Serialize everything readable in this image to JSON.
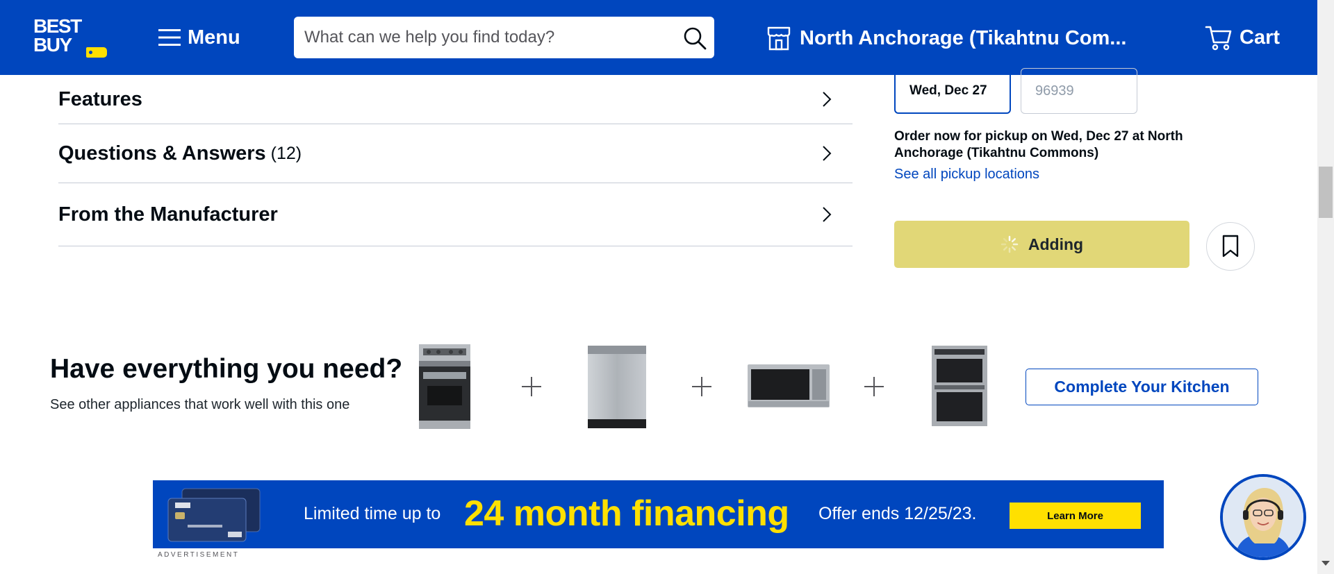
{
  "header": {
    "logo_text": "BEST BUY",
    "menu_label": "Menu",
    "search_placeholder": "What can we help you find today?",
    "store_label": "North Anchorage (Tikahtnu Com...",
    "cart_label": "Cart",
    "brand_color": "#0046be",
    "accent_color": "#ffe000"
  },
  "accordion": [
    {
      "title": "Features",
      "count": ""
    },
    {
      "title": "Questions & Answers",
      "count": "(12)"
    },
    {
      "title": "From the Manufacturer",
      "count": ""
    }
  ],
  "fulfillment": {
    "selected_date": "Wed, Dec 27",
    "zip_placeholder": "96939",
    "pickup_message": "Order now for pickup on Wed, Dec 27 at North Anchorage (Tikahtnu Commons)",
    "pickup_link": "See all pickup locations",
    "add_button_label": "Adding",
    "add_button_color": "#e1d777"
  },
  "kitchen": {
    "title": "Have everything you need?",
    "subtitle": "See other appliances that work well with this one",
    "items": [
      "range-icon",
      "dishwasher-icon",
      "microwave-icon",
      "wall-oven-icon"
    ],
    "button_label": "Complete Your Kitchen"
  },
  "ad": {
    "lead_text": "Limited time up to",
    "headline": "24 month financing",
    "offer_text": "Offer ends 12/25/23.",
    "cta_label": "Learn More",
    "label": "ADVERTISEMENT"
  }
}
